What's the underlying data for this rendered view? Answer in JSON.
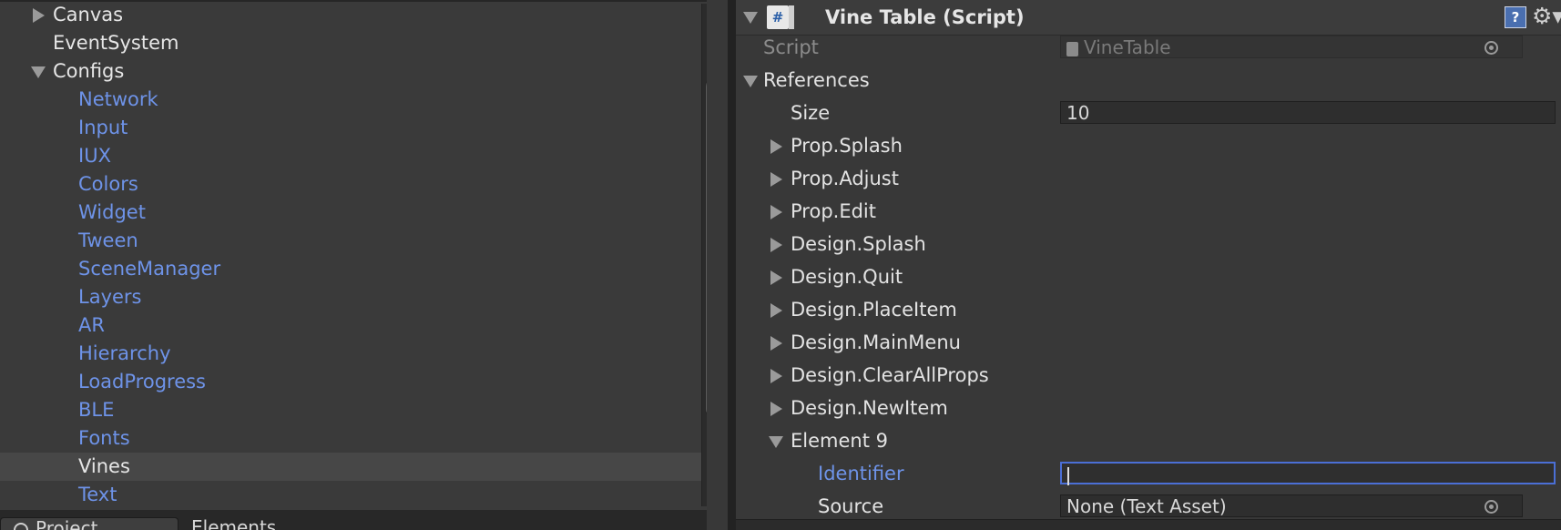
{
  "hierarchy": {
    "items": [
      {
        "label": "Canvas",
        "expanded": false,
        "depth": 0
      },
      {
        "label": "EventSystem",
        "depth": 0
      },
      {
        "label": "Configs",
        "expanded": true,
        "depth": 0
      },
      {
        "label": "Network",
        "depth": 1
      },
      {
        "label": "Input",
        "depth": 1
      },
      {
        "label": "IUX",
        "depth": 1
      },
      {
        "label": "Colors",
        "depth": 1
      },
      {
        "label": "Widget",
        "depth": 1
      },
      {
        "label": "Tween",
        "depth": 1
      },
      {
        "label": "SceneManager",
        "depth": 1
      },
      {
        "label": "Layers",
        "depth": 1
      },
      {
        "label": "AR",
        "depth": 1
      },
      {
        "label": "Hierarchy",
        "depth": 1
      },
      {
        "label": "LoadProgress",
        "depth": 1
      },
      {
        "label": "BLE",
        "depth": 1
      },
      {
        "label": "Fonts",
        "depth": 1
      },
      {
        "label": "Vines",
        "depth": 1,
        "selected": true
      },
      {
        "label": "Text",
        "depth": 1
      }
    ]
  },
  "bottom_tabs": {
    "project": "Project",
    "elements": "Elements"
  },
  "inspector": {
    "component_title": "Vine Table (Script)",
    "help_icon_text": "?",
    "script_label": "Script",
    "script_value": "VineTable",
    "references_label": "References",
    "size_label": "Size",
    "size_value": "10",
    "elements": [
      "Prop.Splash",
      "Prop.Adjust",
      "Prop.Edit",
      "Design.Splash",
      "Design.Quit",
      "Design.PlaceItem",
      "Design.MainMenu",
      "Design.ClearAllProps",
      "Design.NewItem"
    ],
    "element9_label": "Element 9",
    "identifier_label": "Identifier",
    "identifier_value": "",
    "source_label": "Source",
    "source_value": "None (Text Asset)"
  },
  "colors": {
    "prefab_blue": "#6e93e8",
    "background": "#383838",
    "focus_border": "#4b6fd6"
  }
}
